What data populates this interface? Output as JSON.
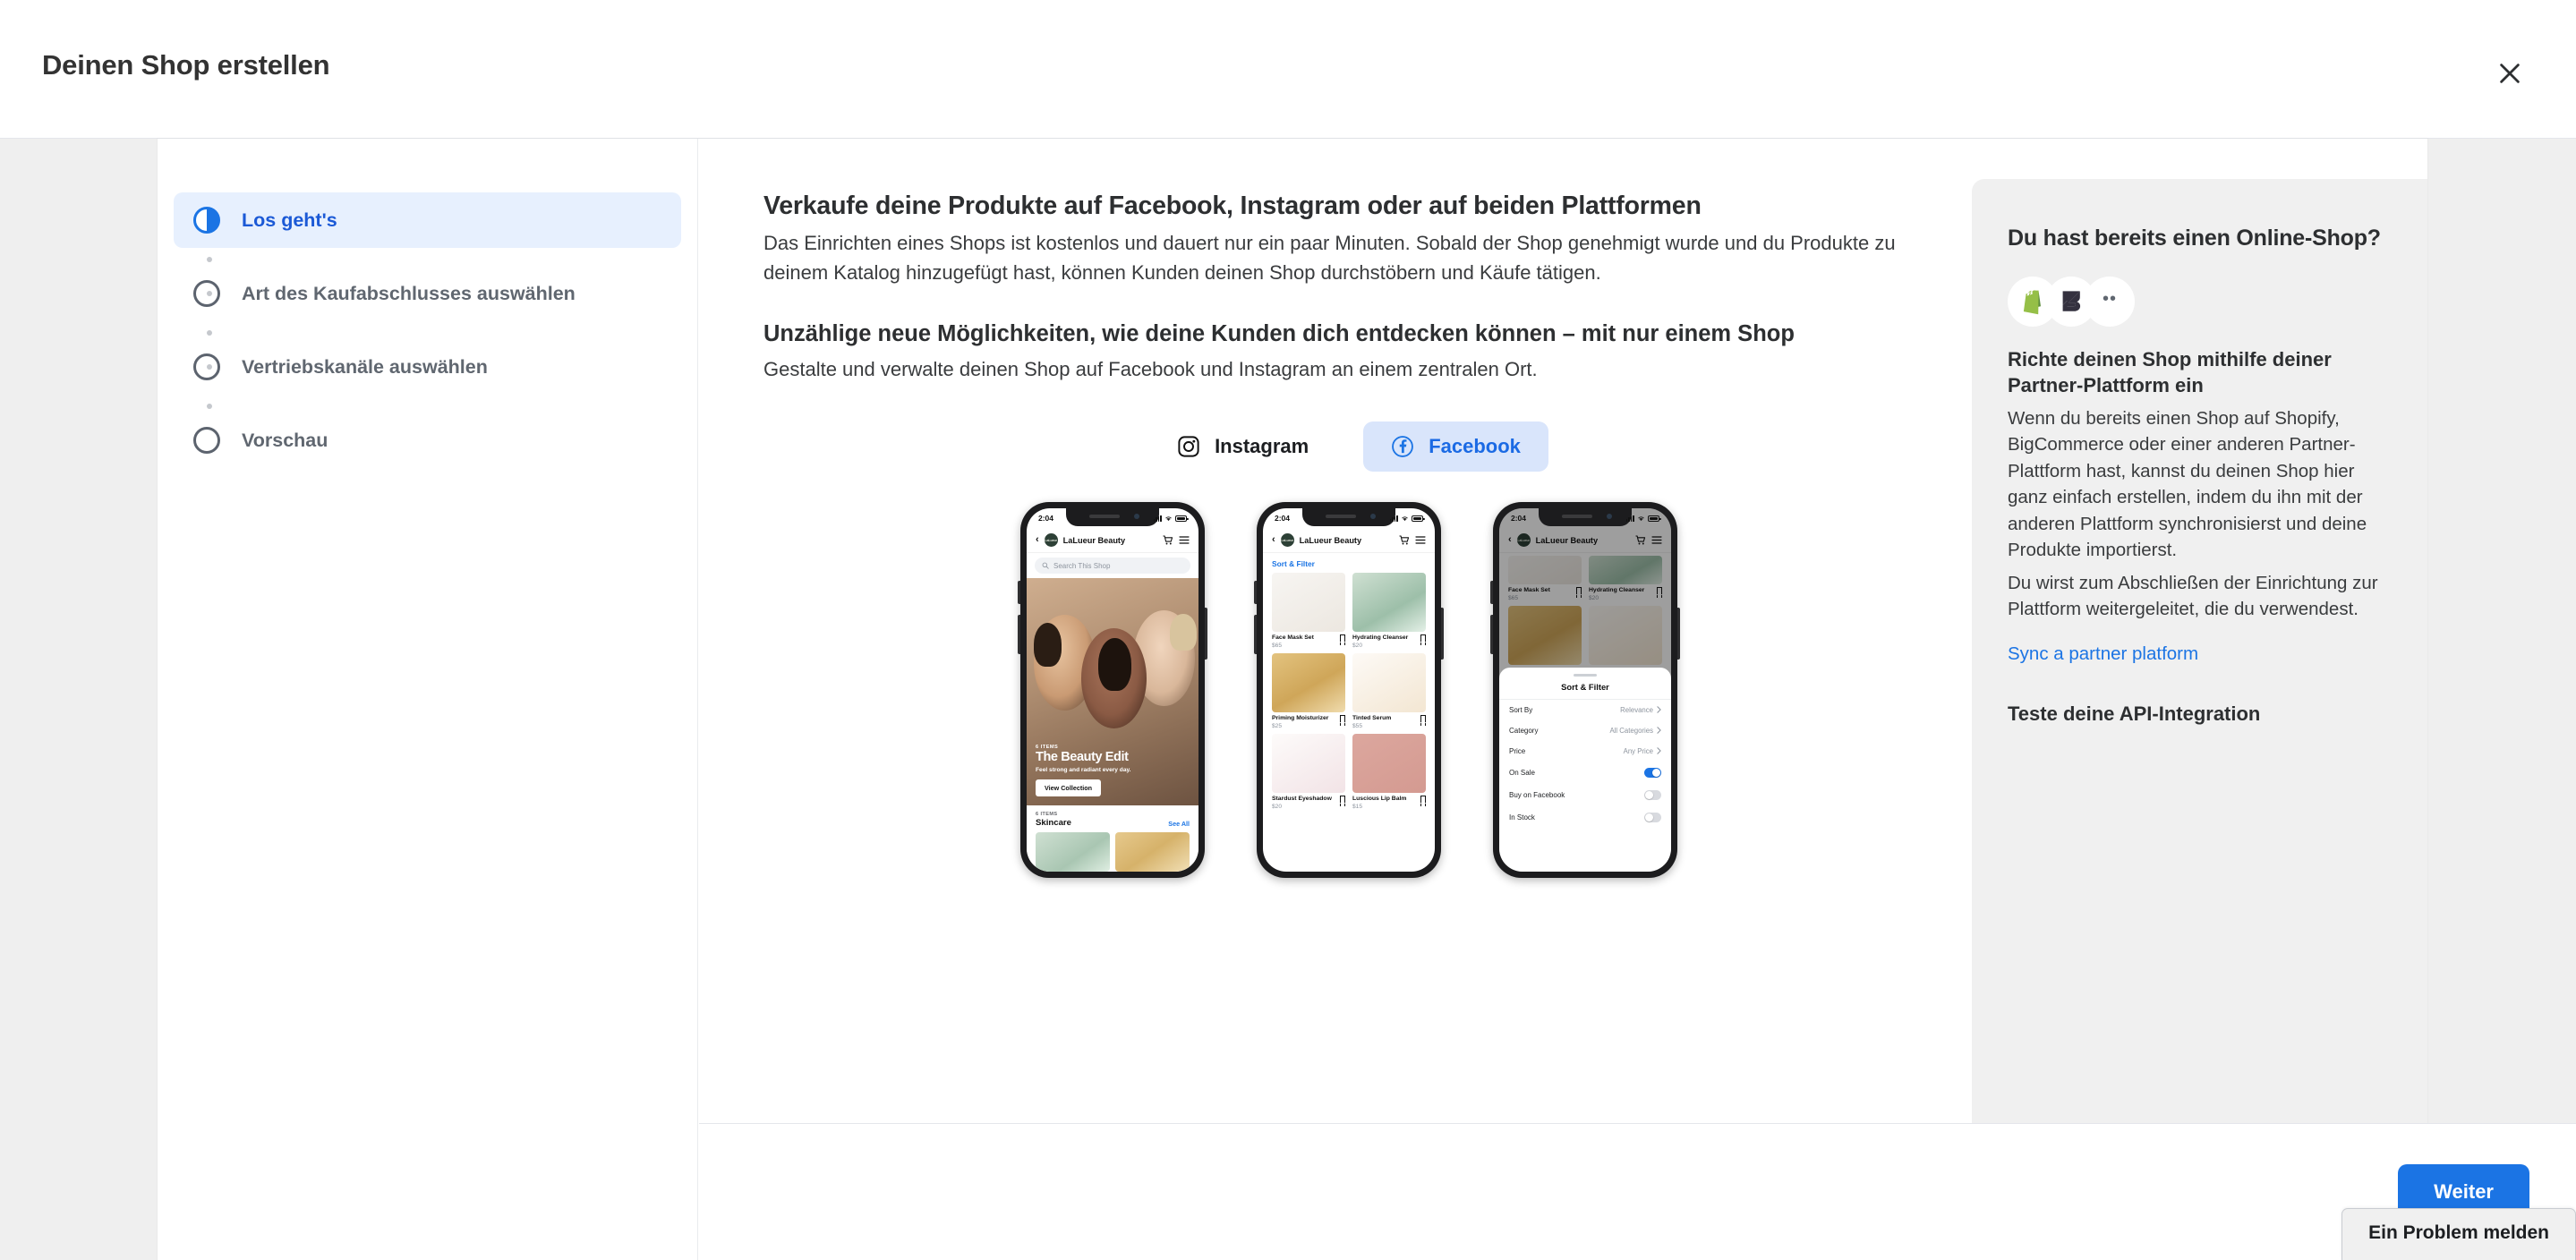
{
  "header": {
    "title": "Deinen Shop erstellen",
    "close_icon": "close-icon"
  },
  "steps": [
    {
      "label": "Los geht's",
      "state": "active"
    },
    {
      "label": "Art des Kaufabschlusses auswählen",
      "state": "pending"
    },
    {
      "label": "Vertriebskanäle auswählen",
      "state": "pending"
    },
    {
      "label": "Vorschau",
      "state": "pending"
    }
  ],
  "content": {
    "heading": "Verkaufe deine Produkte auf Facebook, Instagram oder auf beiden Plattformen",
    "paragraph": "Das Einrichten eines Shops ist kostenlos und dauert nur ein paar Minuten. Sobald der Shop genehmigt wurde und du Produkte zu deinem Katalog hinzugefügt hast, können Kunden deinen Shop durchstöbern und Käufe tätigen.",
    "subheading": "Unzählige neue Möglichkeiten, wie deine Kunden dich entdecken können – mit nur einem Shop",
    "subparagraph": "Gestalte und verwalte deinen Shop auf Facebook und Instagram an einem zentralen Ort.",
    "platforms": [
      {
        "label": "Instagram",
        "icon": "instagram-icon",
        "selected": false
      },
      {
        "label": "Facebook",
        "icon": "facebook-icon",
        "selected": true
      }
    ]
  },
  "phones": {
    "status_time": "2:04",
    "shop_name": "LaLueur Beauty",
    "brand_mark": "LaLueur",
    "search_placeholder": "Search This Shop",
    "home": {
      "hero_eyebrow": "6 ITEMS",
      "hero_title": "The Beauty Edit",
      "hero_sub": "Feel strong and radiant every day.",
      "hero_button": "View Collection",
      "section_eyebrow": "6 ITEMS",
      "section_title": "Skincare",
      "see_all": "See All"
    },
    "grid": {
      "sort_filter_link": "Sort & Filter",
      "products": [
        {
          "name": "Face Mask Set",
          "price": "$65"
        },
        {
          "name": "Hydrating Cleanser",
          "price": "$20"
        },
        {
          "name": "Priming Moisturizer",
          "price": "$25"
        },
        {
          "name": "Tinted Serum",
          "price": "$55"
        },
        {
          "name": "Stardust Eyeshadow",
          "price": "$20"
        },
        {
          "name": "Luscious Lip Balm",
          "price": "$15"
        }
      ]
    },
    "sheet": {
      "title": "Sort & Filter",
      "rows": [
        {
          "label": "Sort By",
          "value": "Relevance",
          "type": "chevron"
        },
        {
          "label": "Category",
          "value": "All Categories",
          "type": "chevron"
        },
        {
          "label": "Price",
          "value": "Any Price",
          "type": "chevron"
        },
        {
          "label": "On Sale",
          "value": "",
          "type": "toggle",
          "on": true
        },
        {
          "label": "Buy on Facebook",
          "value": "",
          "type": "toggle",
          "on": false
        },
        {
          "label": "In Stock",
          "value": "",
          "type": "toggle",
          "on": false
        }
      ]
    }
  },
  "info_panel": {
    "heading": "Du hast bereits einen Online-Shop?",
    "partner_icons": [
      "shopify-icon",
      "bigcommerce-icon",
      "more-platforms-icon"
    ],
    "subheading": "Richte deinen Shop mithilfe deiner Partner-Plattform ein",
    "paragraph1": "Wenn du bereits einen Shop auf Shopify, BigCommerce oder einer anderen Partner-Plattform hast, kannst du deinen Shop hier ganz einfach erstellen, indem du ihn mit der anderen Plattform synchronisierst und deine Produkte importierst.",
    "paragraph2": "Du wirst zum Abschließen der Einrichtung zur Plattform weitergeleitet, die du verwendest.",
    "link": "Sync a partner platform",
    "heading2": "Teste deine API-Integration"
  },
  "footer": {
    "next_label": "Weiter",
    "report_label": "Ein Problem melden"
  },
  "colors": {
    "accent": "#1b74e4",
    "accent_dark": "#1b59d6",
    "pill_bg": "#d9e5fb",
    "step_active_bg": "#e7f0fe",
    "panel_bg": "#f0f0f0",
    "page_bg": "#efefef",
    "text": "#2d2f31",
    "muted": "#606770"
  }
}
